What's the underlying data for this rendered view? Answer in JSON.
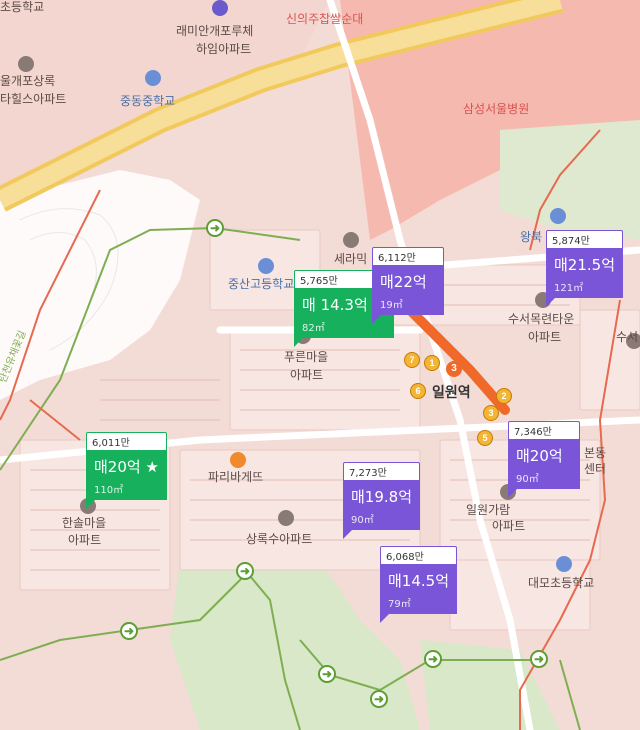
{
  "places": {
    "chodeung_top": "초등학교",
    "sinuijuchapssalsundae": "신의주찹쌀순대",
    "raemian": "래미안개포루체",
    "haim": "하임아파트",
    "gaepo_sangnok": "울개포상록",
    "tahills": "타힐스아파트",
    "jungdong_middle": "중동중학교",
    "samsung_hospital": "삼성서울병원",
    "jungsan_high": "중산고등학교",
    "serami": "세라믹",
    "purun_1": "푸른마을",
    "purun_2": "아파트",
    "wangbuk": "왕북",
    "suseo_1": "수서목련타운",
    "suseo_2": "아파트",
    "suseo_edge": "수서",
    "irwon_station": "일원역",
    "paris_baguette": "파리바게뜨",
    "hansol_1": "한솔마을",
    "hansol_2": "아파트",
    "sangnoksu": "상록수아파트",
    "irwon_garam_1": "일원가람",
    "irwon_garam_2": "아파트",
    "bondong_1": "본동",
    "bondong_2": "센터",
    "daemo_elem": "대모초등학교",
    "trail_label": "탄천유채꽃길"
  },
  "subway": {
    "exits": [
      "7",
      "1",
      "6",
      "2",
      "3",
      "5"
    ],
    "station_line_number": "3",
    "line_color": "#ef6a2a"
  },
  "listings": [
    {
      "count": "5,765만",
      "price": "매 14.3억 ★",
      "area": "82㎡",
      "color": "green"
    },
    {
      "count": "6,112만",
      "price": "매22억",
      "area": "19㎡",
      "color": "purple"
    },
    {
      "count": "5,874만",
      "price": "매21.5억",
      "area": "121㎡",
      "color": "purple"
    },
    {
      "count": "6,011만",
      "price": "매20억 ★",
      "area": "110㎡",
      "color": "green"
    },
    {
      "count": "7,273만",
      "price": "매19.8억",
      "area": "90㎡",
      "color": "purple"
    },
    {
      "count": "7,346만",
      "price": "매20억",
      "area": "90㎡",
      "color": "purple"
    },
    {
      "count": "6,068만",
      "price": "매14.5억",
      "area": "79㎡",
      "color": "purple"
    }
  ],
  "colors": {
    "land": "#f4dcd6",
    "block": "#f8e6e2",
    "road_major": "#f1c95c",
    "green": "#cfe5c0",
    "hospital": "#f6a69b",
    "purple_pin": "#7a55d8",
    "green_pin": "#17b05c",
    "boundary": "#e66a50"
  }
}
